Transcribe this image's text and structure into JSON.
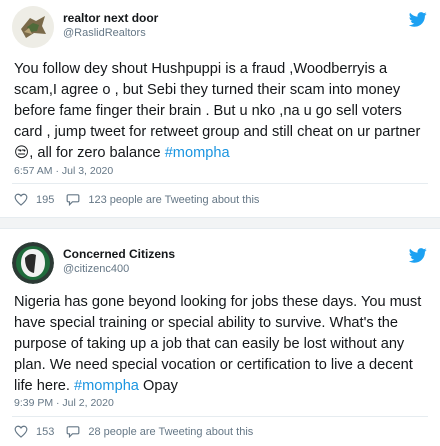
{
  "tweets": [
    {
      "name": "realtor next door",
      "handle": "@RaslidRealtors",
      "text_before": "You follow dey shout Hushpuppi is a fraud ,Woodberryis a scam,I agree o , but Sebi they turned their scam into money before fame finger their brain . But u nko ,na u go sell voters card , jump tweet for retweet group and still cheat on ur partner😒, all for zero balance ",
      "hashtag": "#mompha",
      "text_after": "",
      "timestamp": "6:57 AM · Jul 3, 2020",
      "likes": "195",
      "tweeting_about": "123 people are Tweeting about this"
    },
    {
      "name": "Concerned Citizens",
      "handle": "@citizenc400",
      "text_before": "Nigeria has gone beyond looking for jobs these days. You must have special training or special ability to survive. What's the purpose of taking up a job that can easily be lost without any plan. We need special vocation or certification to live a decent life here. ",
      "hashtag": "#mompha",
      "text_after": " Opay",
      "timestamp": "9:39 PM · Jul 2, 2020",
      "likes": "153",
      "tweeting_about": "28 people are Tweeting about this"
    }
  ],
  "icons": {
    "twitter": "twitter-bird-icon",
    "like": "heart-icon",
    "reply": "speech-bubble-icon"
  },
  "colors": {
    "brand": "#1da1f2",
    "hashtag": "#1b95e0",
    "secondary_text": "#657786",
    "divider": "#e6ecf0"
  }
}
